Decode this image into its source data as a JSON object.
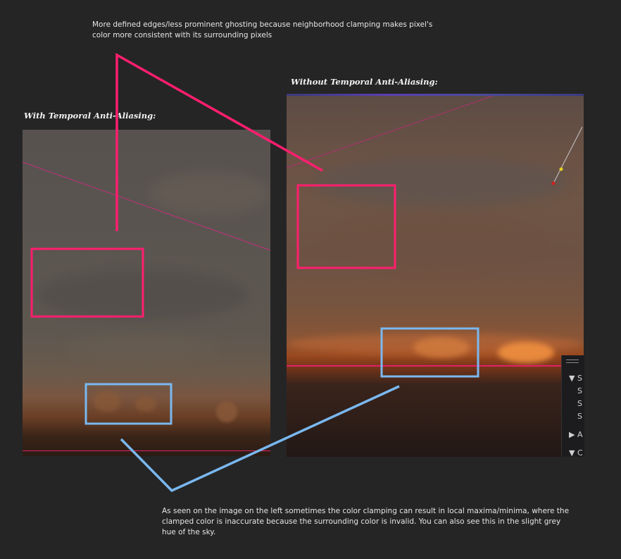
{
  "notes": {
    "top": "More defined edges/less prominent ghosting because neighborhood clamping makes pixel's color more consistent with its surrounding pixels",
    "bottom": "As seen on the image on the left sometimes the color clamping can result in local maxima/minima, where the clamped color is inaccurate because the surrounding color is invalid. You can also see this in the slight grey hue of the sky."
  },
  "captions": {
    "left": "With Temporal Anti-Aliasing:",
    "right": "Without Temporal Anti-Aliasing:"
  },
  "colors": {
    "background": "#252526",
    "highlight_pink": "#ff1e6e",
    "highlight_blue": "#7ab8f0",
    "horizon_line": "#e0206a"
  },
  "panel": {
    "items": [
      "▼ S",
      "S",
      "S",
      "S",
      "▶ A",
      "▼ C"
    ]
  }
}
